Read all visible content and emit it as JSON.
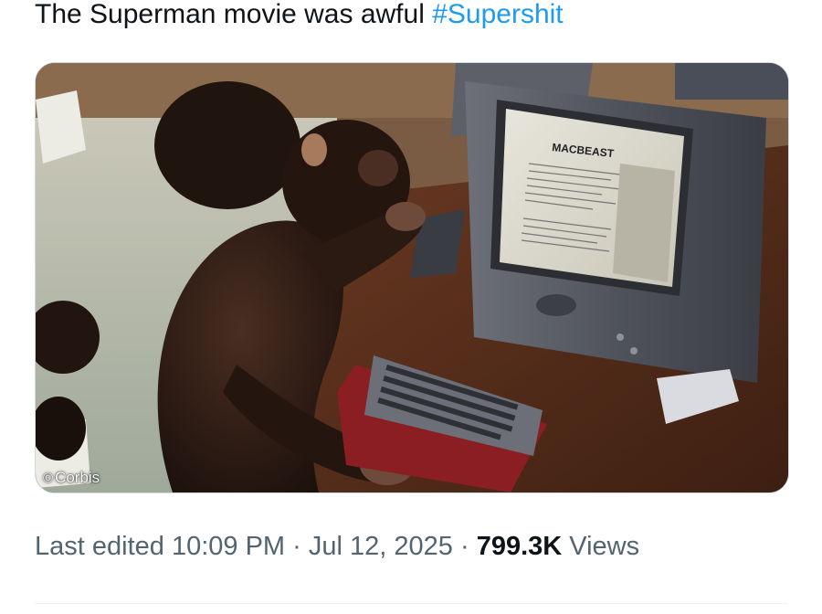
{
  "tweet": {
    "text": "The Superman movie was awful ",
    "hashtag": "#Supershit"
  },
  "media": {
    "screen_title": "MACBEAST",
    "credit": "Corbis",
    "credit_icon": "copyright-icon"
  },
  "meta": {
    "edited_label": "Last edited",
    "time": "10:09 PM",
    "separator": "·",
    "date": "Jul 12, 2025",
    "views_count": "799.3K",
    "views_label": "Views"
  },
  "colors": {
    "hashtag": "#1d9bf0",
    "text": "#0f1419",
    "secondary": "#536471"
  }
}
